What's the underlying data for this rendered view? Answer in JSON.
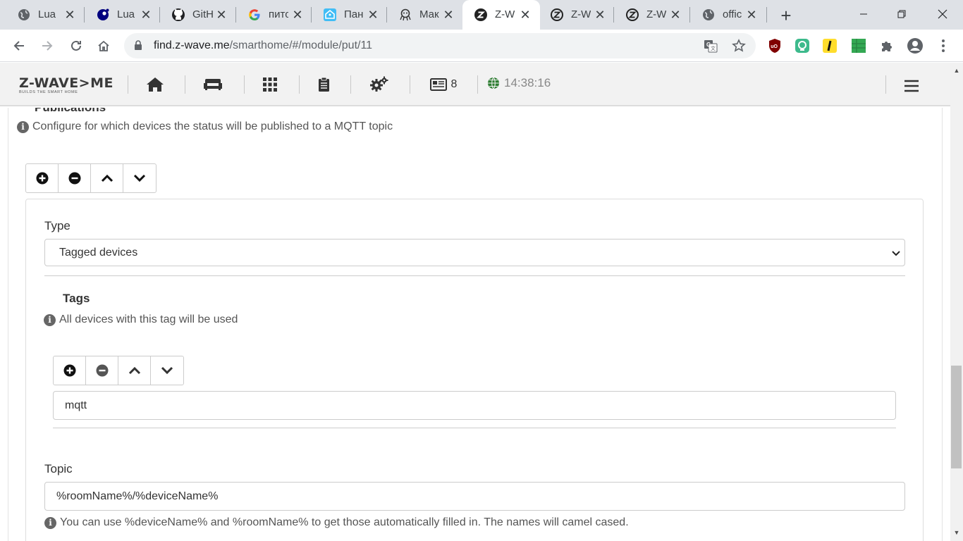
{
  "browser": {
    "tabs": [
      {
        "title": "Lua",
        "icon": "globe-icon"
      },
      {
        "title": "Lua",
        "icon": "lua-icon"
      },
      {
        "title": "GitH",
        "icon": "github-icon"
      },
      {
        "title": "пито",
        "icon": "google-icon"
      },
      {
        "title": "Пан",
        "icon": "home-assistant-icon"
      },
      {
        "title": "Мак",
        "icon": "octopus-icon"
      },
      {
        "title": "Z-W",
        "icon": "zwave-icon",
        "active": true
      },
      {
        "title": "Z-W",
        "icon": "zwave-icon"
      },
      {
        "title": "Z-W",
        "icon": "zwave-icon"
      },
      {
        "title": "offic",
        "icon": "globe-icon"
      }
    ],
    "url_host": "find.z-wave.me",
    "url_path": "/smarthome/#/module/put/11"
  },
  "appbar": {
    "logo_main": "Z-WAVE>ME",
    "logo_sub": "BUILDS THE SMART HOME",
    "notifications_count": "8",
    "clock": "14:38:16"
  },
  "publications": {
    "title": "Publications",
    "help": "Configure for which devices the status will be published to a MQTT topic",
    "type_label": "Type",
    "type_value": "Tagged devices",
    "tags": {
      "title": "Tags",
      "help": "All devices with this tag will be used",
      "value": "mqtt"
    },
    "topic": {
      "label": "Topic",
      "value": "%roomName%/%deviceName%",
      "help": "You can use %deviceName% and %roomName% to get those automatically filled in. The names will camel cased."
    }
  },
  "colors": {
    "appbar_bg": "#f2f2f2",
    "tabstrip_bg": "#dee1e6",
    "clock_icon": "#2e7d32",
    "ublock": "#800000"
  }
}
